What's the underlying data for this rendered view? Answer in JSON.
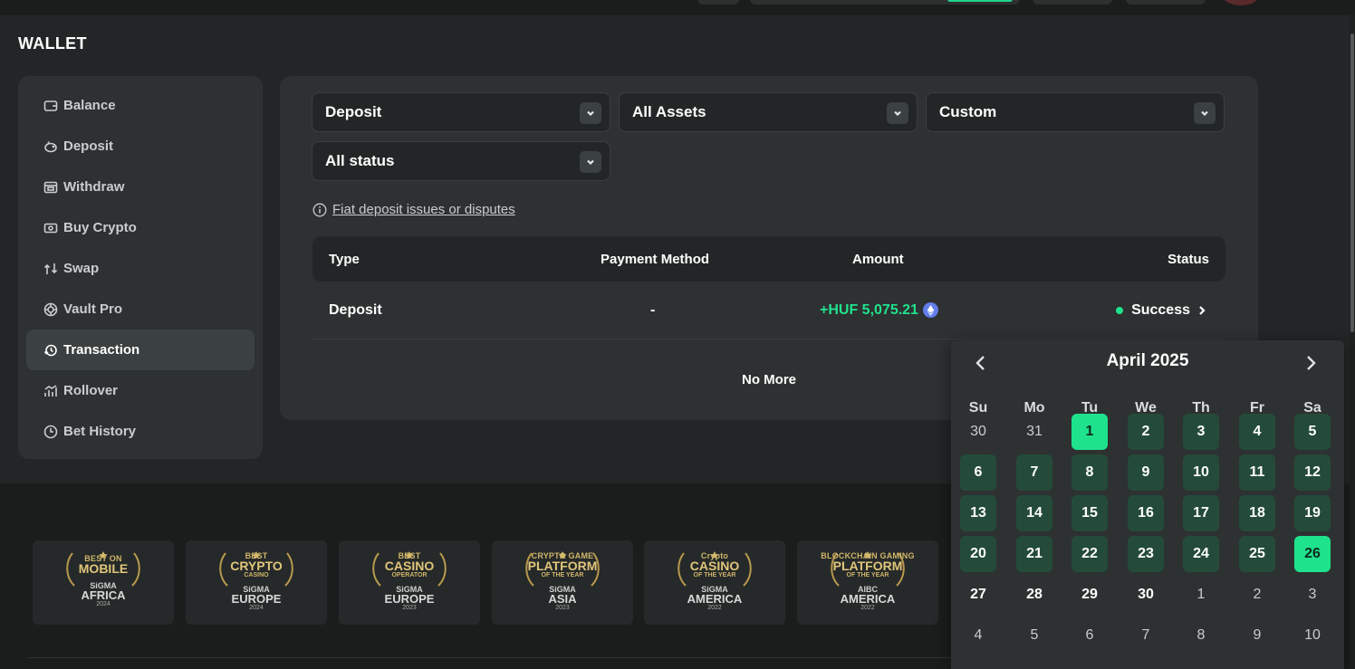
{
  "page": {
    "title": "WALLET"
  },
  "sidebar": {
    "items": [
      {
        "label": "Balance",
        "icon": "wallet-icon",
        "active": false
      },
      {
        "label": "Deposit",
        "icon": "piggy-bank-icon",
        "active": false
      },
      {
        "label": "Withdraw",
        "icon": "withdraw-icon",
        "active": false
      },
      {
        "label": "Buy Crypto",
        "icon": "cash-icon",
        "active": false
      },
      {
        "label": "Swap",
        "icon": "swap-icon",
        "active": false
      },
      {
        "label": "Vault Pro",
        "icon": "vault-icon",
        "active": false
      },
      {
        "label": "Transaction",
        "icon": "transaction-icon",
        "active": true
      },
      {
        "label": "Rollover",
        "icon": "chart-icon",
        "active": false
      },
      {
        "label": "Bet History",
        "icon": "clock-icon",
        "active": false
      }
    ]
  },
  "filters": {
    "type": "Deposit",
    "assets": "All Assets",
    "date_range": "Custom",
    "status": "All status"
  },
  "fiat_link": "Fiat deposit issues or disputes",
  "table": {
    "headers": {
      "type": "Type",
      "method": "Payment Method",
      "amount": "Amount",
      "status": "Status"
    },
    "rows": [
      {
        "type": "Deposit",
        "method": "-",
        "amount": "+HUF 5,075.21",
        "status": "Success"
      }
    ],
    "footer": "No More"
  },
  "calendar": {
    "month_label": "April 2025",
    "weekdays": [
      "Su",
      "Mo",
      "Tu",
      "We",
      "Th",
      "Fr",
      "Sa"
    ],
    "weeks": [
      [
        "30",
        "31",
        "1",
        "2",
        "3",
        "4",
        "5"
      ],
      [
        "6",
        "7",
        "8",
        "9",
        "10",
        "11",
        "12"
      ],
      [
        "13",
        "14",
        "15",
        "16",
        "17",
        "18",
        "19"
      ],
      [
        "20",
        "21",
        "22",
        "23",
        "24",
        "25",
        "26"
      ],
      [
        "27",
        "28",
        "29",
        "30",
        "1",
        "2",
        "3"
      ],
      [
        "4",
        "5",
        "6",
        "7",
        "8",
        "9",
        "10"
      ]
    ],
    "range_start": "1",
    "range_end": "26",
    "colors": {
      "selected": "#1fe28d",
      "in_range": "#244b39"
    }
  },
  "awards": [
    {
      "line1": "BEST ON",
      "line2": "MOBILE",
      "line3": "",
      "org": "SiGMA",
      "region": "AFRICA",
      "year": "2024"
    },
    {
      "line1": "BEST",
      "line2": "CRYPTO",
      "line3": "CASINO",
      "org": "SiGMA",
      "region": "EUROPE",
      "year": "2024"
    },
    {
      "line1": "BEST",
      "line2": "CASINO",
      "line3": "OPERATOR",
      "org": "SiGMA",
      "region": "EUROPE",
      "year": "2023"
    },
    {
      "line1": "CRYPTO GAME",
      "line2": "PLATFORM",
      "line3": "OF THE YEAR",
      "org": "SiGMA",
      "region": "ASIA",
      "year": "2023"
    },
    {
      "line1": "Crypto",
      "line2": "CASINO",
      "line3": "OF THE YEAR",
      "org": "SiGMA",
      "region": "AMERICA",
      "year": "2022"
    },
    {
      "line1": "BLOCKCHAIN GAMING",
      "line2": "PLATFORM",
      "line3": "OF THE YEAR",
      "org": "AIBC",
      "region": "AMERICA",
      "year": "2022"
    }
  ],
  "colors": {
    "accent": "#1fe28d",
    "panel": "#2d3131",
    "background": "#232626"
  }
}
